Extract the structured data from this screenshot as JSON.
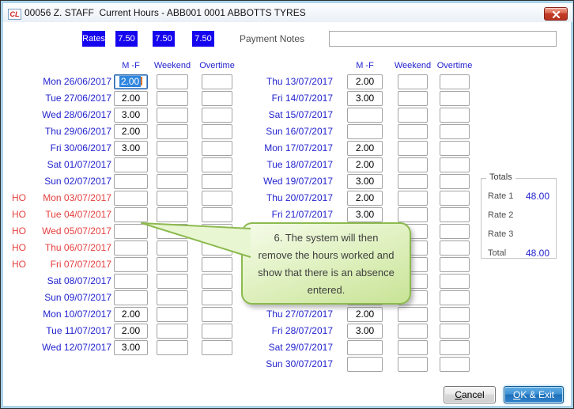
{
  "window": {
    "title": "00056 Z. STAFF  Current Hours - ABB001 0001 ABBOTTS TYRES",
    "icon_text": "CL"
  },
  "rates": {
    "label": "Rates",
    "values": [
      "7.50",
      "7.50",
      "7.50"
    ]
  },
  "payment_notes": {
    "label": "Payment Notes",
    "value": ""
  },
  "columns": {
    "mf": "M -F",
    "weekend": "Weekend",
    "overtime": "Overtime"
  },
  "left_rows": [
    {
      "ho": "",
      "label": "Mon 26/06/2017",
      "mf": "2.00",
      "weekend": "",
      "overtime": "",
      "holiday": false,
      "selected": true
    },
    {
      "ho": "",
      "label": "Tue 27/06/2017",
      "mf": "2.00",
      "weekend": "",
      "overtime": "",
      "holiday": false
    },
    {
      "ho": "",
      "label": "Wed 28/06/2017",
      "mf": "3.00",
      "weekend": "",
      "overtime": "",
      "holiday": false
    },
    {
      "ho": "",
      "label": "Thu 29/06/2017",
      "mf": "2.00",
      "weekend": "",
      "overtime": "",
      "holiday": false
    },
    {
      "ho": "",
      "label": "Fri 30/06/2017",
      "mf": "3.00",
      "weekend": "",
      "overtime": "",
      "holiday": false
    },
    {
      "ho": "",
      "label": "Sat 01/07/2017",
      "mf": "",
      "weekend": "",
      "overtime": "",
      "holiday": false
    },
    {
      "ho": "",
      "label": "Sun 02/07/2017",
      "mf": "",
      "weekend": "",
      "overtime": "",
      "holiday": false
    },
    {
      "ho": "HO",
      "label": "Mon 03/07/2017",
      "mf": "",
      "weekend": "",
      "overtime": "",
      "holiday": true
    },
    {
      "ho": "HO",
      "label": "Tue 04/07/2017",
      "mf": "",
      "weekend": "",
      "overtime": "",
      "holiday": true
    },
    {
      "ho": "HO",
      "label": "Wed 05/07/2017",
      "mf": "",
      "weekend": "",
      "overtime": "",
      "holiday": true
    },
    {
      "ho": "HO",
      "label": "Thu 06/07/2017",
      "mf": "",
      "weekend": "",
      "overtime": "",
      "holiday": true
    },
    {
      "ho": "HO",
      "label": "Fri 07/07/2017",
      "mf": "",
      "weekend": "",
      "overtime": "",
      "holiday": true
    },
    {
      "ho": "",
      "label": "Sat 08/07/2017",
      "mf": "",
      "weekend": "",
      "overtime": "",
      "holiday": false
    },
    {
      "ho": "",
      "label": "Sun 09/07/2017",
      "mf": "",
      "weekend": "",
      "overtime": "",
      "holiday": false
    },
    {
      "ho": "",
      "label": "Mon 10/07/2017",
      "mf": "2.00",
      "weekend": "",
      "overtime": "",
      "holiday": false
    },
    {
      "ho": "",
      "label": "Tue 11/07/2017",
      "mf": "2.00",
      "weekend": "",
      "overtime": "",
      "holiday": false
    },
    {
      "ho": "",
      "label": "Wed 12/07/2017",
      "mf": "3.00",
      "weekend": "",
      "overtime": "",
      "holiday": false
    }
  ],
  "right_rows": [
    {
      "label": "Thu 13/07/2017",
      "mf": "2.00",
      "weekend": "",
      "overtime": "",
      "holiday": false
    },
    {
      "label": "Fri 14/07/2017",
      "mf": "3.00",
      "weekend": "",
      "overtime": "",
      "holiday": false
    },
    {
      "label": "Sat 15/07/2017",
      "mf": "",
      "weekend": "",
      "overtime": "",
      "holiday": false
    },
    {
      "label": "Sun 16/07/2017",
      "mf": "",
      "weekend": "",
      "overtime": "",
      "holiday": false
    },
    {
      "label": "Mon 17/07/2017",
      "mf": "2.00",
      "weekend": "",
      "overtime": "",
      "holiday": false
    },
    {
      "label": "Tue 18/07/2017",
      "mf": "2.00",
      "weekend": "",
      "overtime": "",
      "holiday": false
    },
    {
      "label": "Wed 19/07/2017",
      "mf": "3.00",
      "weekend": "",
      "overtime": "",
      "holiday": false
    },
    {
      "label": "Thu 20/07/2017",
      "mf": "2.00",
      "weekend": "",
      "overtime": "",
      "holiday": false
    },
    {
      "label": "Fri 21/07/2017",
      "mf": "3.00",
      "weekend": "",
      "overtime": "",
      "holiday": false
    },
    {
      "label": "",
      "mf": "",
      "weekend": "",
      "overtime": "",
      "holiday": false
    },
    {
      "label": "",
      "mf": "",
      "weekend": "",
      "overtime": "",
      "holiday": false
    },
    {
      "label": "",
      "mf": "",
      "weekend": "",
      "overtime": "",
      "holiday": false
    },
    {
      "label": "",
      "mf": "",
      "weekend": "",
      "overtime": "",
      "holiday": false
    },
    {
      "label": "",
      "mf": "",
      "weekend": "",
      "overtime": "",
      "holiday": false
    },
    {
      "label": "Thu 27/07/2017",
      "mf": "2.00",
      "weekend": "",
      "overtime": "",
      "holiday": false
    },
    {
      "label": "Fri 28/07/2017",
      "mf": "3.00",
      "weekend": "",
      "overtime": "",
      "holiday": false
    },
    {
      "label": "Sat 29/07/2017",
      "mf": "",
      "weekend": "",
      "overtime": "",
      "holiday": false
    },
    {
      "label": "Sun 30/07/2017",
      "mf": "",
      "weekend": "",
      "overtime": "",
      "holiday": false
    }
  ],
  "totals": {
    "legend": "Totals",
    "rows": [
      {
        "label": "Rate 1",
        "value": "48.00"
      },
      {
        "label": "Rate 2",
        "value": ""
      },
      {
        "label": "Rate 3",
        "value": ""
      },
      {
        "label": "Total",
        "value": "48.00"
      }
    ]
  },
  "callout": {
    "lines": [
      "6. The system will then",
      "remove the hours worked and",
      "show that there is an absence",
      "entered."
    ]
  },
  "buttons": {
    "cancel": {
      "accel": "C",
      "rest": "ancel"
    },
    "ok_exit": {
      "accel": "O",
      "rest": "K & Exit"
    }
  },
  "colors": {
    "date_blue": "#2323cf",
    "holiday_red": "#e5403f",
    "rate_chip_blue": "#1505ee",
    "selection_blue": "#2e86e0",
    "callout_green_border": "#8cba4f",
    "ok_button_blue": "#2f83cd"
  }
}
